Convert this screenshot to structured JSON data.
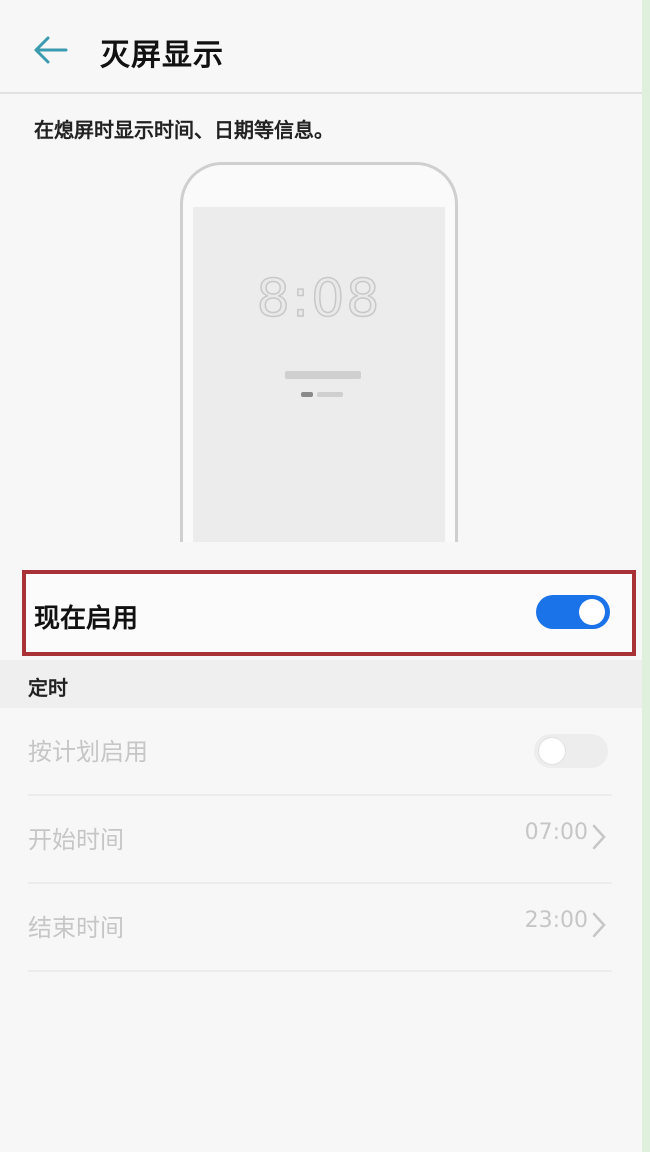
{
  "header": {
    "title": "灭屏显示",
    "back_icon": "arrow-left-icon"
  },
  "description": "在熄屏时显示时间、日期等信息。",
  "preview": {
    "time": "8:08"
  },
  "enable_now": {
    "label": "现在启用",
    "toggle_on": true,
    "accent_color": "#1a73e8"
  },
  "schedule_section": {
    "title": "定时",
    "rows": [
      {
        "label": "按计划启用",
        "type": "toggle",
        "toggle_on": false
      },
      {
        "label": "开始时间",
        "value": "07:00",
        "type": "link"
      },
      {
        "label": "结束时间",
        "value": "23:00",
        "type": "link"
      }
    ]
  },
  "highlight_color": "#a83236"
}
